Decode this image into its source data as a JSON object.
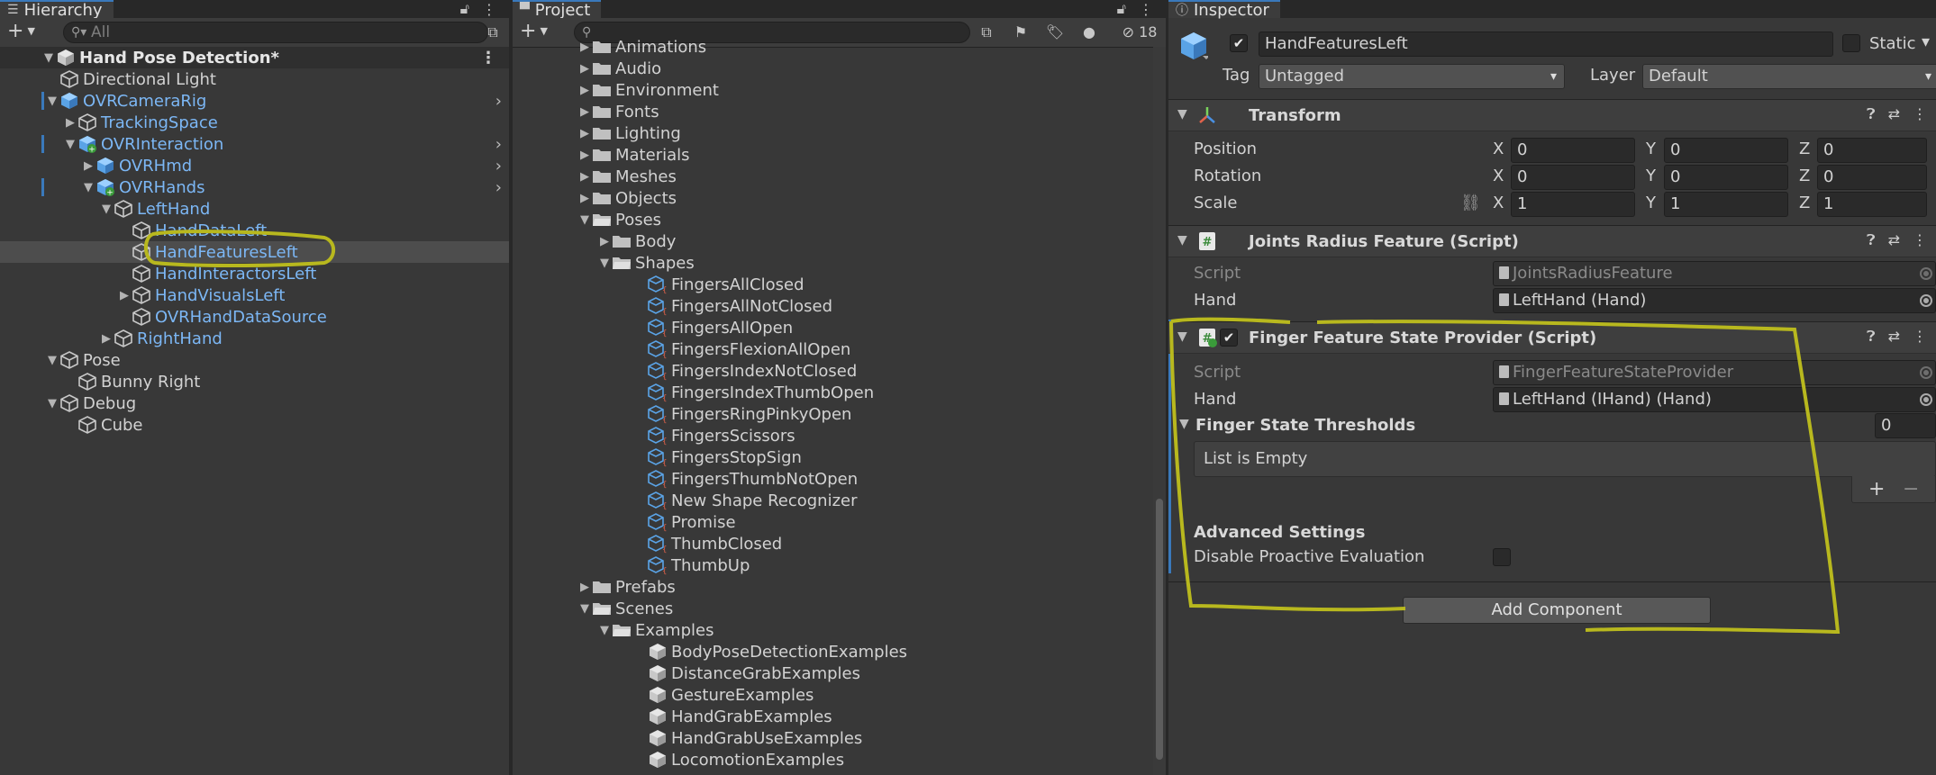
{
  "hierarchy": {
    "tab_label": "Hierarchy",
    "search_placeholder": "All",
    "scene_name": "Hand Pose Detection*",
    "items": [
      {
        "label": "Directional Light",
        "depth": 1
      },
      {
        "label": "OVRCameraRig",
        "depth": 1
      },
      {
        "label": "TrackingSpace",
        "depth": 2
      },
      {
        "label": "OVRInteraction",
        "depth": 2
      },
      {
        "label": "OVRHmd",
        "depth": 3
      },
      {
        "label": "OVRHands",
        "depth": 3
      },
      {
        "label": "LeftHand",
        "depth": 4
      },
      {
        "label": "HandDataLeft",
        "depth": 5
      },
      {
        "label": "HandFeaturesLeft",
        "depth": 5
      },
      {
        "label": "HandInteractorsLeft",
        "depth": 5
      },
      {
        "label": "HandVisualsLeft",
        "depth": 5
      },
      {
        "label": "OVRHandDataSource",
        "depth": 5
      },
      {
        "label": "RightHand",
        "depth": 4
      },
      {
        "label": "Pose",
        "depth": 1
      },
      {
        "label": "Bunny Right",
        "depth": 2
      },
      {
        "label": "Debug",
        "depth": 1
      },
      {
        "label": "Cube",
        "depth": 2
      }
    ]
  },
  "project": {
    "tab_label": "Project",
    "hidden_count": "18",
    "items": [
      {
        "label": "Animations"
      },
      {
        "label": "Audio"
      },
      {
        "label": "Environment"
      },
      {
        "label": "Fonts"
      },
      {
        "label": "Lighting"
      },
      {
        "label": "Materials"
      },
      {
        "label": "Meshes"
      },
      {
        "label": "Objects"
      },
      {
        "label": "Poses"
      },
      {
        "label": "Body"
      },
      {
        "label": "Shapes"
      },
      {
        "label": "FingersAllClosed"
      },
      {
        "label": "FingersAllNotClosed"
      },
      {
        "label": "FingersAllOpen"
      },
      {
        "label": "FingersFlexionAllOpen"
      },
      {
        "label": "FingersIndexNotClosed"
      },
      {
        "label": "FingersIndexThumbOpen"
      },
      {
        "label": "FingersRingPinkyOpen"
      },
      {
        "label": "FingersScissors"
      },
      {
        "label": "FingersStopSign"
      },
      {
        "label": "FingersThumbNotOpen"
      },
      {
        "label": "New Shape Recognizer"
      },
      {
        "label": "Promise"
      },
      {
        "label": "ThumbClosed"
      },
      {
        "label": "ThumbUp"
      },
      {
        "label": "Prefabs"
      },
      {
        "label": "Scenes"
      },
      {
        "label": "Examples"
      },
      {
        "label": "BodyPoseDetectionExamples"
      },
      {
        "label": "DistanceGrabExamples"
      },
      {
        "label": "GestureExamples"
      },
      {
        "label": "HandGrabExamples"
      },
      {
        "label": "HandGrabUseExamples"
      },
      {
        "label": "LocomotionExamples"
      }
    ]
  },
  "inspector": {
    "tab_label": "Inspector",
    "object_name": "HandFeaturesLeft",
    "static_label": "Static",
    "tag_label": "Tag",
    "tag_value": "Untagged",
    "layer_label": "Layer",
    "layer_value": "Default",
    "transform": {
      "title": "Transform",
      "position_label": "Position",
      "rotation_label": "Rotation",
      "scale_label": "Scale",
      "axis_x": "X",
      "axis_y": "Y",
      "axis_z": "Z",
      "position": [
        "0",
        "0",
        "0"
      ],
      "rotation": [
        "0",
        "0",
        "0"
      ],
      "scale": [
        "1",
        "1",
        "1"
      ]
    },
    "joints": {
      "title": "Joints Radius Feature (Script)",
      "script_label": "Script",
      "script_value": "JointsRadiusFeature",
      "hand_label": "Hand",
      "hand_value": "LeftHand (Hand)"
    },
    "finger": {
      "title": "Finger Feature State Provider (Script)",
      "script_label": "Script",
      "script_value": "FingerFeatureStateProvider",
      "hand_label": "Hand",
      "hand_value": "LeftHand (IHand) (Hand)",
      "thresholds_label": "Finger State Thresholds",
      "thresholds_count": "0",
      "list_empty": "List is Empty",
      "add_glyph": "+",
      "remove_glyph": "−",
      "advanced_label": "Advanced Settings",
      "disable_label": "Disable Proactive Evaluation"
    },
    "add_component": "Add Component"
  },
  "colors": {
    "prefab_text": "#7cb7f5",
    "selection": "#4d4d4d",
    "annotation": "#b8b81e",
    "accent": "#3a79bb"
  }
}
